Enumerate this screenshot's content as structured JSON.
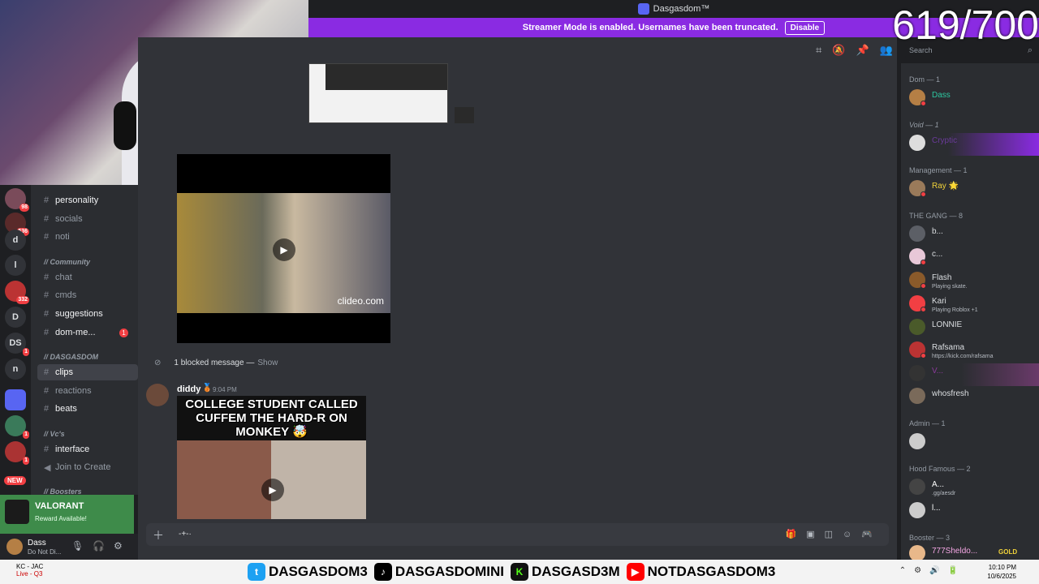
{
  "window": {
    "title": "Dasgasdom™"
  },
  "banner": {
    "text": "Streamer Mode is enabled. Usernames have been truncated.",
    "button": "Disable"
  },
  "overlay": {
    "counter": "619/700"
  },
  "search": {
    "placeholder": "Search"
  },
  "servers": [
    {
      "label": "",
      "badge": "98"
    },
    {
      "label": "",
      "badge": "536"
    },
    {
      "label": "d",
      "badge": ""
    },
    {
      "label": "l",
      "badge": ""
    },
    {
      "label": "",
      "badge": "332"
    },
    {
      "label": "D",
      "badge": ""
    },
    {
      "label": "DS",
      "badge": "1"
    },
    {
      "label": "n",
      "badge": ""
    },
    {
      "label": "",
      "badge": ""
    },
    {
      "label": "",
      "badge": "1"
    },
    {
      "label": "",
      "badge": "1"
    }
  ],
  "new_label": "NEW",
  "channels": {
    "items": [
      {
        "name": "personality",
        "bold": true,
        "badge": ""
      },
      {
        "name": "socials",
        "bold": false,
        "badge": ""
      },
      {
        "name": "noti",
        "bold": false,
        "badge": ""
      },
      {
        "name": "chat",
        "bold": false,
        "badge": ""
      },
      {
        "name": "cmds",
        "bold": false,
        "badge": ""
      },
      {
        "name": "suggestions",
        "bold": true,
        "badge": ""
      },
      {
        "name": "dom-me...",
        "bold": true,
        "badge": "1"
      },
      {
        "name": "clips",
        "bold": true,
        "badge": ""
      },
      {
        "name": "reactions",
        "bold": false,
        "badge": ""
      },
      {
        "name": "beats",
        "bold": true,
        "badge": ""
      },
      {
        "name": "interface",
        "bold": true,
        "badge": ""
      },
      {
        "name": "Join to Create",
        "bold": false,
        "badge": ""
      }
    ],
    "categories": [
      "// Community",
      "// DASGASDOM",
      "// Vc's",
      "// Boosters"
    ]
  },
  "promo": {
    "title": "VALORANT",
    "subtitle": "Reward Available!"
  },
  "user": {
    "name": "Dass",
    "status": "Do Not Di..."
  },
  "chat": {
    "video1_watermark": "clideo.com",
    "blocked": "1 blocked message —",
    "blocked_show": "Show",
    "message": {
      "author": "diddy",
      "time": "9:04 PM",
      "caption": "COLLEGE STUDENT CALLED CUFFEM THE HARD-R ON MONKEY 🤯"
    },
    "composer_text": "-+-·"
  },
  "members": {
    "groups": [
      {
        "title": "Dom — 1",
        "members": [
          {
            "name": "Dass",
            "sub": ""
          }
        ]
      },
      {
        "title": "Void — 1",
        "members": [
          {
            "name": "Cryptic",
            "sub": ""
          }
        ]
      },
      {
        "title": "Management — 1",
        "members": [
          {
            "name": "Ray 🌟",
            "sub": ""
          }
        ]
      },
      {
        "title": "THE GANG — 8",
        "members": [
          {
            "name": "b...",
            "sub": ""
          },
          {
            "name": "c...",
            "sub": ""
          },
          {
            "name": "Flash",
            "sub": "Playing skate."
          },
          {
            "name": "Kari",
            "sub": "Playing Roblox +1"
          },
          {
            "name": "LONNIE",
            "sub": ""
          },
          {
            "name": "Rafsama",
            "sub": "https://kick.com/rafsama"
          },
          {
            "name": "V...",
            "sub": ""
          },
          {
            "name": "whosfresh",
            "sub": ""
          }
        ]
      },
      {
        "title": "Admin — 1",
        "members": [
          {
            "name": "",
            "sub": ""
          }
        ]
      },
      {
        "title": "Hood Famous — 2",
        "members": [
          {
            "name": "A...",
            "sub": ".gg/aesdr"
          },
          {
            "name": "l...",
            "sub": ""
          }
        ]
      },
      {
        "title": "Booster — 3",
        "members": [
          {
            "name": "777Sheldo...",
            "sub": "GOLD"
          }
        ]
      }
    ]
  },
  "taskbar": {
    "weather": "KC - JAC",
    "weather_sub": "Live - Q3",
    "socials": [
      "DASGASDOM3",
      "DASGASDOMINI",
      "DASGASD3M",
      "NOTDASGASDOM3"
    ],
    "time": "10:10 PM",
    "date": "10/6/2025"
  },
  "colors": {
    "accent": "#8a2be2",
    "discord_bg": "#313338",
    "sidebar": "#2b2d31",
    "danger": "#f23f43"
  }
}
